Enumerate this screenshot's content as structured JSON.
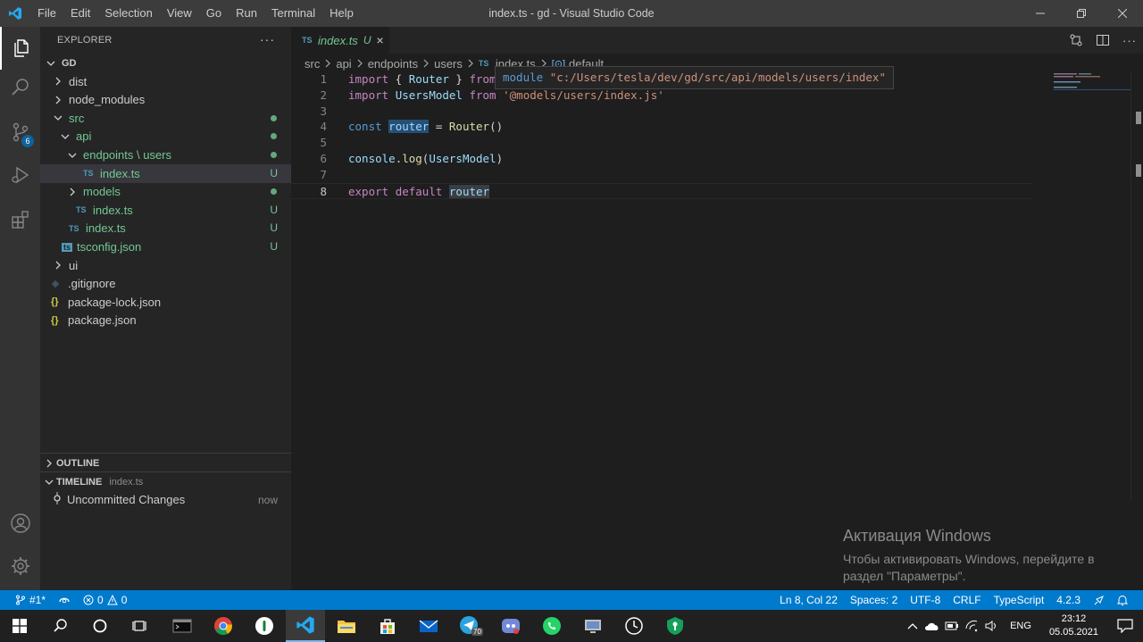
{
  "window": {
    "title": "index.ts - gd - Visual Studio Code",
    "menu": [
      "File",
      "Edit",
      "Selection",
      "View",
      "Go",
      "Run",
      "Terminal",
      "Help"
    ]
  },
  "activity_bar": {
    "source_control_badge": "6"
  },
  "sidebar": {
    "header": "EXPLORER",
    "more": "···",
    "tree": [
      {
        "label": "GD",
        "depth": 0,
        "kind": "folder-open",
        "bold": true
      },
      {
        "label": "dist",
        "depth": 1,
        "kind": "folder"
      },
      {
        "label": "node_modules",
        "depth": 1,
        "kind": "folder"
      },
      {
        "label": "src",
        "depth": 1,
        "kind": "folder-open",
        "status": "dot",
        "green": true
      },
      {
        "label": "api",
        "depth": 2,
        "kind": "folder-open",
        "status": "dot",
        "green": true
      },
      {
        "label": "endpoints \\ users",
        "depth": 3,
        "kind": "folder-open",
        "status": "dot",
        "green": true
      },
      {
        "label": "index.ts",
        "depth": 4,
        "kind": "ts",
        "status": "U",
        "green": true,
        "selected": true
      },
      {
        "label": "models",
        "depth": 3,
        "kind": "folder",
        "status": "dot",
        "green": true
      },
      {
        "label": "index.ts",
        "depth": 3,
        "kind": "ts",
        "status": "U",
        "green": true
      },
      {
        "label": "index.ts",
        "depth": 2,
        "kind": "ts",
        "status": "U",
        "green": true
      },
      {
        "label": "tsconfig.json",
        "depth": 2,
        "kind": "tsconfig",
        "status": "U",
        "green": true
      },
      {
        "label": "ui",
        "depth": 1,
        "kind": "folder"
      },
      {
        "label": ".gitignore",
        "depth": 1,
        "kind": "git"
      },
      {
        "label": "package-lock.json",
        "depth": 1,
        "kind": "json"
      },
      {
        "label": "package.json",
        "depth": 1,
        "kind": "json"
      }
    ],
    "outline_label": "OUTLINE",
    "timeline_label": "TIMELINE",
    "timeline_file": "index.ts",
    "timeline_entry": "Uncommitted Changes",
    "timeline_time": "now"
  },
  "editor": {
    "tab": {
      "icon": "TS",
      "name": "index.ts",
      "status": "U",
      "close": "×"
    },
    "breadcrumb": [
      "src",
      "api",
      "endpoints",
      "users",
      "index.ts",
      "default"
    ],
    "lines": [
      {
        "n": "1",
        "tokens": [
          [
            "kw",
            "import"
          ],
          [
            "pun",
            " { "
          ],
          [
            "var",
            "Router"
          ],
          [
            "pun",
            " } "
          ],
          [
            "kw",
            "from"
          ]
        ]
      },
      {
        "n": "2",
        "tokens": [
          [
            "kw",
            "import"
          ],
          [
            "pun",
            " "
          ],
          [
            "var",
            "UsersModel"
          ],
          [
            "pun",
            " "
          ],
          [
            "kw",
            "from"
          ],
          [
            "pun",
            " "
          ],
          [
            "str",
            "'@models/users/index.js'"
          ]
        ]
      },
      {
        "n": "3",
        "tokens": []
      },
      {
        "n": "4",
        "tokens": [
          [
            "kw2",
            "const"
          ],
          [
            "pun",
            " "
          ],
          [
            "var hl",
            "router"
          ],
          [
            "pun",
            " = "
          ],
          [
            "fn",
            "Router"
          ],
          [
            "pun",
            "()"
          ]
        ]
      },
      {
        "n": "5",
        "tokens": []
      },
      {
        "n": "6",
        "tokens": [
          [
            "var",
            "console"
          ],
          [
            "pun",
            "."
          ],
          [
            "fn",
            "log"
          ],
          [
            "pun",
            "("
          ],
          [
            "var",
            "UsersModel"
          ],
          [
            "pun",
            ")"
          ]
        ]
      },
      {
        "n": "7",
        "tokens": []
      },
      {
        "n": "8",
        "tokens": [
          [
            "kw",
            "export"
          ],
          [
            "pun",
            " "
          ],
          [
            "kw",
            "default"
          ],
          [
            "pun",
            " "
          ],
          [
            "var hl2",
            "router"
          ]
        ],
        "current": true
      }
    ],
    "hover_keyword": "module",
    "hover_path": "\"c:/Users/tesla/dev/gd/src/api/models/users/index\"",
    "watermark_title": "Активация Windows",
    "watermark_line1": "Чтобы активировать Windows, перейдите в",
    "watermark_line2": "раздел \"Параметры\"."
  },
  "statusbar": {
    "branch": "#1*",
    "errors": "0",
    "warnings": "0",
    "position": "Ln 8, Col 22",
    "spaces": "Spaces: 2",
    "encoding": "UTF-8",
    "eol": "CRLF",
    "language": "TypeScript",
    "ts_version": "4.2.3"
  },
  "taskbar": {
    "telegram_badge": "70",
    "lang": "ENG",
    "time": "23:12",
    "date": "05.05.2021"
  },
  "colors": {
    "accent": "#007acc",
    "git_added": "#73c991",
    "title_bar": "#3c3c3c",
    "sidebar": "#252526",
    "editor": "#1e1e1e"
  }
}
